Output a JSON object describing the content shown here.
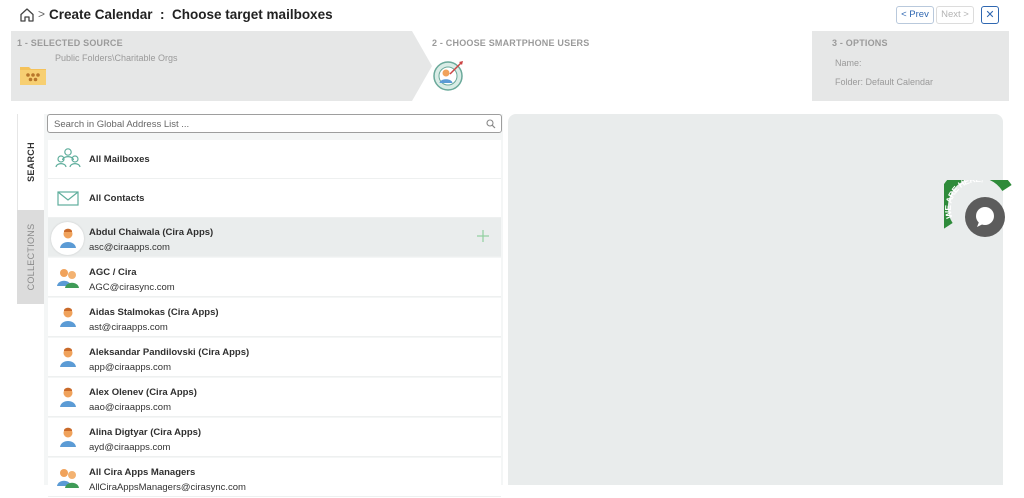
{
  "header": {
    "title": "Create Calendar  :  Choose target mailboxes",
    "breadcrumb_separator": ">",
    "prev_label": "< Prev",
    "next_label": "Next >",
    "close_label": "✕"
  },
  "steps": [
    {
      "label": "1 - SELECTED SOURCE",
      "lines": [
        "Public Folders\\Charitable Orgs"
      ],
      "icon": "folder-people-icon",
      "state": "done"
    },
    {
      "label": "2 - CHOOSE SMARTPHONE USERS",
      "lines": [],
      "icon": "target-user-icon",
      "state": "active"
    },
    {
      "label": "3 - OPTIONS",
      "lines": [
        "Name:",
        "Folder: Default Calendar"
      ],
      "icon": "",
      "state": "pending"
    }
  ],
  "side_tabs": [
    {
      "label": "SEARCH",
      "active": true
    },
    {
      "label": "COLLECTIONS",
      "active": false
    }
  ],
  "search": {
    "placeholder": "Search in Global Address List ...",
    "value": ""
  },
  "special_items": [
    {
      "label": "All Mailboxes",
      "icon": "users-group-icon"
    },
    {
      "label": "All Contacts",
      "icon": "envelope-icon"
    }
  ],
  "people": [
    {
      "name": "Abdul Chaiwala (Cira Apps)",
      "email": "asc@ciraapps.com",
      "type": "user",
      "selected": true
    },
    {
      "name": "AGC / Cira",
      "email": "AGC@cirasync.com",
      "type": "group",
      "selected": false
    },
    {
      "name": "Aidas Stalmokas (Cira Apps)",
      "email": "ast@ciraapps.com",
      "type": "user",
      "selected": false
    },
    {
      "name": "Aleksandar Pandilovski (Cira Apps)",
      "email": "app@ciraapps.com",
      "type": "user",
      "selected": false
    },
    {
      "name": "Alex Olenev (Cira Apps)",
      "email": "aao@ciraapps.com",
      "type": "user",
      "selected": false
    },
    {
      "name": "Alina Digtyar (Cira Apps)",
      "email": "ayd@ciraapps.com",
      "type": "user",
      "selected": false
    },
    {
      "name": "All Cira Apps Managers",
      "email": "AllCiraAppsManagers@cirasync.com",
      "type": "group",
      "selected": false
    }
  ],
  "chat_widget": {
    "text": "WE ARE HERE!"
  },
  "colors": {
    "accent": "#2f67b1",
    "green": "#2e8b3a",
    "avatar_orange": "#f08a3c",
    "avatar_blue": "#5b9bd5",
    "panel_gray": "#e9ecec"
  }
}
